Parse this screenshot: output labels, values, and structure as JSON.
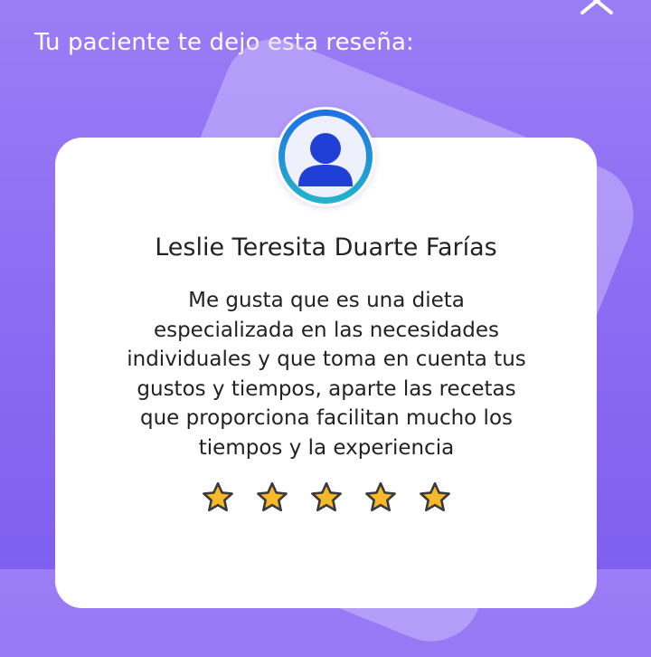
{
  "header": {
    "title": "Tu paciente te dejo esta reseña:"
  },
  "icons": {
    "close": "close-icon",
    "avatar": "user-avatar-icon",
    "star": "star-icon"
  },
  "review": {
    "reviewer_name": "Leslie Teresita Duarte Farías",
    "text_lines": [
      "Me gusta que es una dieta",
      "especializada en las necesidades",
      "individuales y que toma en cuenta tus",
      "gustos y tiempos, aparte las recetas",
      "que proporciona facilitan mucho los",
      "tiempos y la experiencia"
    ],
    "rating": 5,
    "rating_max": 5
  },
  "colors": {
    "background_top": "#9b7df6",
    "background_bottom": "#7f5fee",
    "card": "#ffffff",
    "avatar_ring_start": "#1f6fe6",
    "avatar_ring_end": "#23b4c9",
    "avatar_silhouette": "#1f3fd6",
    "star_fill": "#f7b928",
    "star_outline": "#3a3a3a"
  }
}
